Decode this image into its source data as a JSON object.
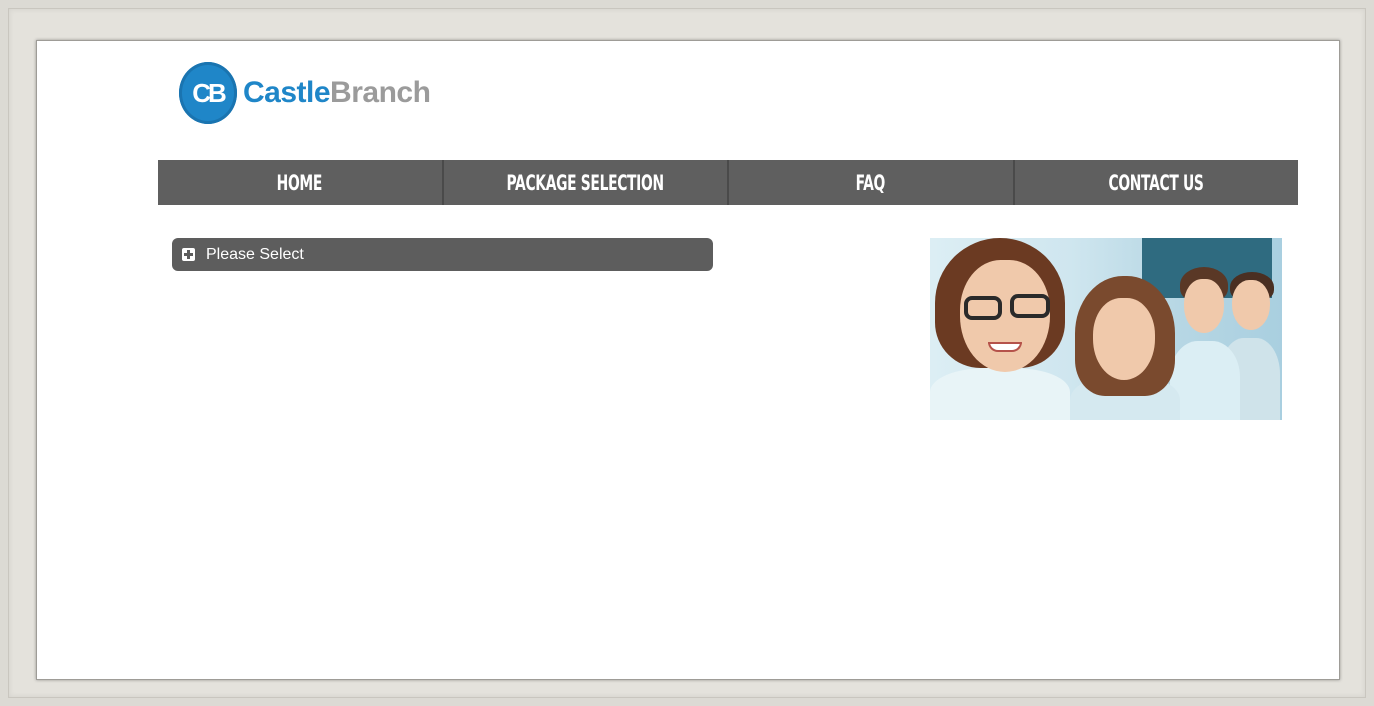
{
  "brand": {
    "logo_mark": "CB",
    "name_part1": "Castle",
    "name_part2": "Branch",
    "mark_color": "#1f86c8",
    "secondary_color": "#9b9b9b"
  },
  "nav": {
    "items": [
      {
        "label": "HOME"
      },
      {
        "label": "PACKAGE SELECTION"
      },
      {
        "label": "FAQ"
      },
      {
        "label": "CONTACT US"
      }
    ],
    "background": "#5f5f5f"
  },
  "selector": {
    "label": "Please Select",
    "icon": "plus-box-icon"
  },
  "hero": {
    "image": "healthcare-professionals-photo"
  }
}
